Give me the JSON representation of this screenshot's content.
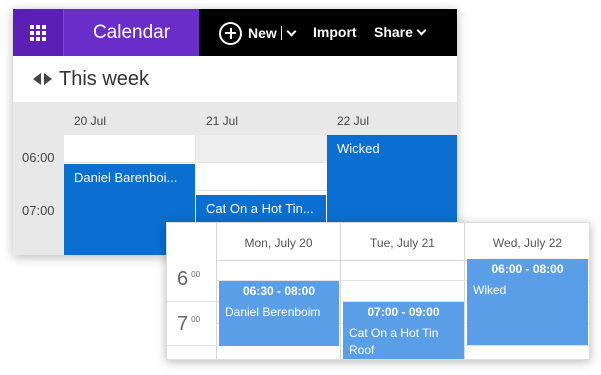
{
  "outlook": {
    "app_title": "Calendar",
    "toolbar": {
      "new_label": "New",
      "import_label": "Import",
      "share_label": "Share"
    },
    "week_title": "This week",
    "days": [
      "20 Jul",
      "21 Jul",
      "22 Jul"
    ],
    "times": [
      "06:00",
      "07:00"
    ],
    "events": [
      {
        "title": "Daniel Barenboi..."
      },
      {
        "title": "Cat On a Hot Tin..."
      },
      {
        "title": "Wicked"
      }
    ],
    "colors": {
      "waffle": "#5b1fb5",
      "title": "#6a2dc7",
      "event": "#0a6fd0"
    }
  },
  "scheduler": {
    "days": [
      "Mon, July 20",
      "Tue, July 21",
      "Wed, July 22"
    ],
    "times": [
      {
        "hour": "6",
        "minutes": "00"
      },
      {
        "hour": "7",
        "minutes": "00"
      }
    ],
    "events": [
      {
        "time": "06:30 - 08:00",
        "title": "Daniel Berenboim"
      },
      {
        "time": "07:00 - 09:00",
        "title": "Cat On a Hot Tin Roof"
      },
      {
        "time": "06:00 - 08:00",
        "title": "Wiked"
      }
    ],
    "colors": {
      "event": "#5a9ee8"
    }
  }
}
